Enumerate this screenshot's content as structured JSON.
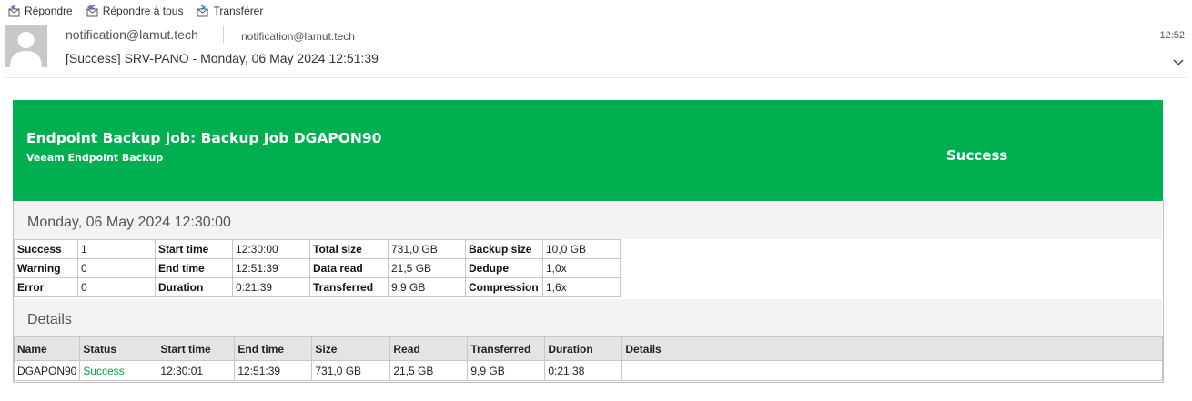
{
  "toolbar": {
    "reply": "Répondre",
    "reply_all": "Répondre à tous",
    "forward": "Transférer"
  },
  "header": {
    "from": "notification@lamut.tech",
    "to": "notification@lamut.tech",
    "subject": "[Success] SRV-PANO - Monday, 06 May 2024 12:51:39",
    "time": "12:52"
  },
  "banner": {
    "title": "Endpoint Backup job: Backup Job DGAPON90",
    "subtitle": "Veeam Endpoint Backup",
    "status": "Success",
    "color": "#00b050"
  },
  "summary": {
    "date": "Monday, 06 May 2024 12:30:00",
    "rows": [
      [
        "Success",
        "1",
        "Start time",
        "12:30:00",
        "Total size",
        "731,0 GB",
        "Backup size",
        "10,0 GB"
      ],
      [
        "Warning",
        "0",
        "End time",
        "12:51:39",
        "Data read",
        "21,5 GB",
        "Dedupe",
        "1,0x"
      ],
      [
        "Error",
        "0",
        "Duration",
        "0:21:39",
        "Transferred",
        "9,9 GB",
        "Compression",
        "1,6x"
      ]
    ]
  },
  "details": {
    "heading": "Details",
    "columns": [
      "Name",
      "Status",
      "Start time",
      "End time",
      "Size",
      "Read",
      "Transferred",
      "Duration",
      "Details"
    ],
    "rows": [
      [
        "DGAPON90",
        "Success",
        "12:30:01",
        "12:51:39",
        "731,0 GB",
        "21,5 GB",
        "9,9 GB",
        "0:21:38",
        ""
      ]
    ],
    "success_color": "#00a040"
  }
}
